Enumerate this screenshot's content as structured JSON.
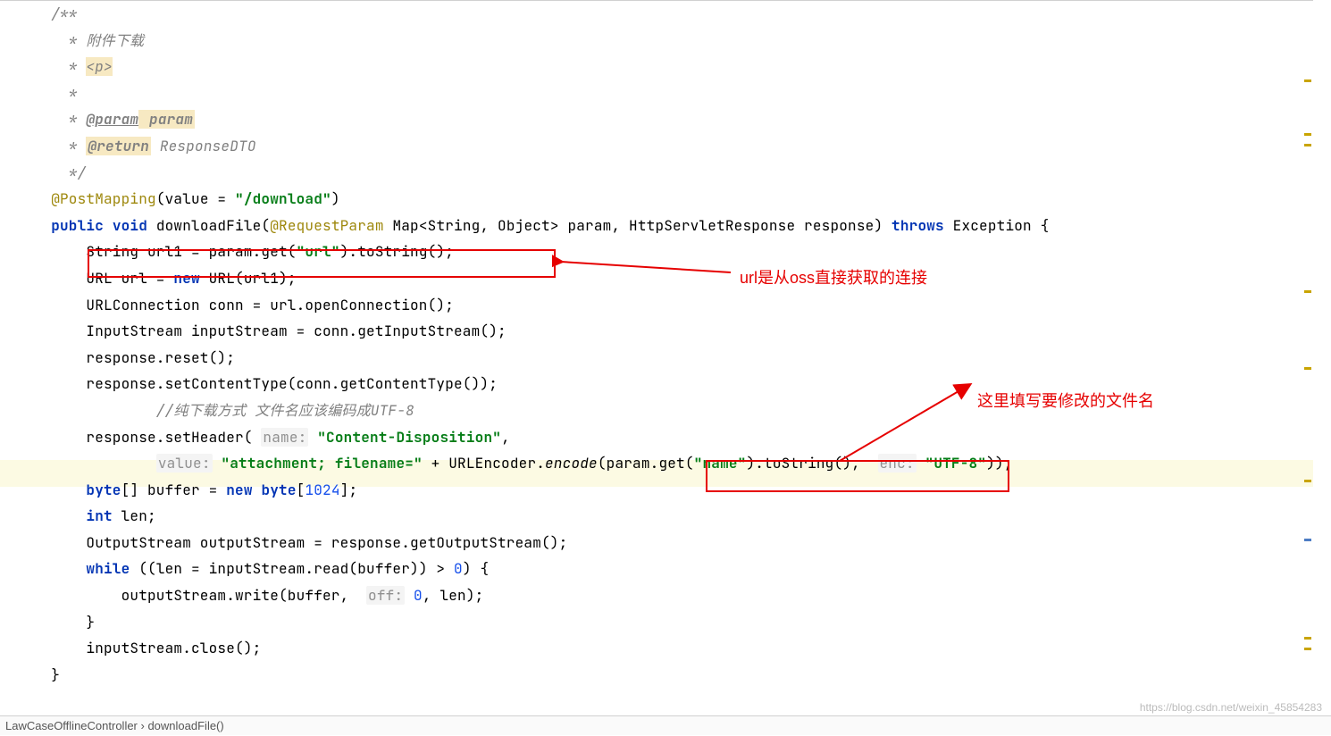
{
  "comment": {
    "open": "/**",
    "line1": " * 附件下载",
    "line2_pre": " * ",
    "line2_tag": "<p>",
    "line3": " *",
    "param_pre": " * ",
    "param_tag": "@param",
    "param_name": " param",
    "return_pre": " * ",
    "return_tag": "@return",
    "return_type": " ResponseDTO",
    "close": " */"
  },
  "ann": {
    "postmapping": "@PostMapping",
    "requestparam": "@RequestParam"
  },
  "kw": {
    "public": "public",
    "void": "void",
    "throws": "throws",
    "new": "new",
    "byte": "byte",
    "int": "int",
    "while": "while"
  },
  "hint": {
    "name": "name:",
    "value": "value:",
    "off": "off:",
    "enc": "enc:"
  },
  "str": {
    "download": "\"/download\"",
    "urlkey": "\"url\"",
    "cd": "\"Content-Disposition\"",
    "attach": "\"attachment; filename=\"",
    "namekey": "\"name\"",
    "utf8": "\"UTF-8\""
  },
  "num": {
    "n1024": "1024",
    "n0": "0",
    "z0": "0"
  },
  "code": {
    "value_eq": "(value = ",
    "close_paren": ")",
    "sig1": " downloadFile(",
    "sig2": " Map<String, Object> param, HttpServletResponse response) ",
    "sig3": " Exception {",
    "l1": "String url1 = param.get(",
    "l1b": ").toString();",
    "l2a": "URL url = ",
    "l2b": " URL(url1);",
    "l3": "URLConnection conn = url.openConnection();",
    "l4": "InputStream inputStream = conn.getInputStream();",
    "l5": "response.reset();",
    "l6": "response.setContentType(conn.getContentType());",
    "cmnt": "        //纯下载方式 文件名应该编码成UTF-8",
    "l7a": "response.setHeader( ",
    "l7b": " ",
    "l7c": ",",
    "l8a": "        ",
    "l8b": " ",
    "l8c": " + URLEncoder.",
    "encode": "encode",
    "l8d": "(param.get(",
    "l8e": ").toString(),  ",
    "l8f": " ",
    "l8g": "));",
    "l9a": "[] buffer = ",
    "l9b": " ",
    "l9c": "[",
    "l9d": "];",
    "l10": " len;",
    "l11": "OutputStream outputStream = response.getOutputStream();",
    "l12a": " ((len = inputStream.read(buffer)) > ",
    "l12b": ") {",
    "l13a": "    outputStream.write(buffer,  ",
    "l13b": " ",
    "l13c": ", len);",
    "l14": "}",
    "l15": "inputStream.close();",
    "l16": "}"
  },
  "annotations": {
    "label1": "url是从oss直接获取的连接",
    "label2": "这里填写要修改的文件名"
  },
  "breadcrumb": {
    "a": "LawCaseOfflineController",
    "sep": " › ",
    "b": "downloadFile()"
  },
  "watermark": "https://blog.csdn.net/weixin_45854283"
}
